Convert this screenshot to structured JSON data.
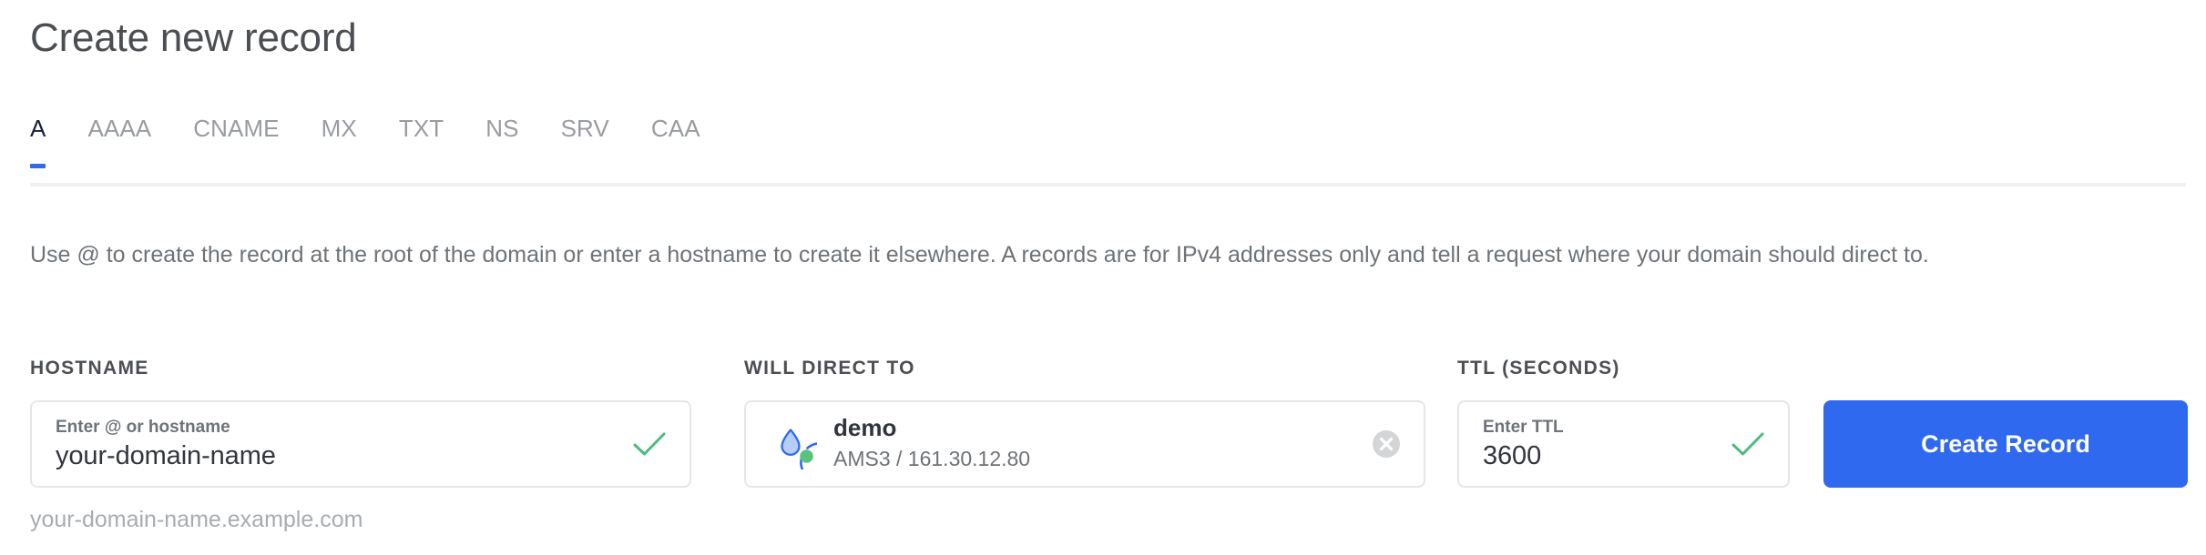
{
  "header": {
    "title": "Create new record"
  },
  "tabs": {
    "active_index": 0,
    "items": [
      {
        "label": "A"
      },
      {
        "label": "AAAA"
      },
      {
        "label": "CNAME"
      },
      {
        "label": "MX"
      },
      {
        "label": "TXT"
      },
      {
        "label": "NS"
      },
      {
        "label": "SRV"
      },
      {
        "label": "CAA"
      }
    ]
  },
  "description": "Use @ to create the record at the root of the domain or enter a hostname to create it elsewhere. A records are for IPv4 addresses only and tell a request where your domain should direct to.",
  "form": {
    "hostname": {
      "label": "HOSTNAME",
      "placeholder": "Enter @ or hostname",
      "value": "your-domain-name",
      "valid_icon": "check-icon",
      "helper_text": "your-domain-name.example.com"
    },
    "will_direct_to": {
      "label": "WILL DIRECT TO",
      "resource_icon": "droplet-icon",
      "resource_name": "demo",
      "resource_meta": "AMS3 / 161.30.12.80",
      "clear_icon": "clear-circle-icon"
    },
    "ttl": {
      "label": "TTL (SECONDS)",
      "placeholder": "Enter TTL",
      "value": "3600",
      "valid_icon": "check-icon"
    },
    "submit": {
      "label": "Create Record"
    }
  },
  "colors": {
    "accent_blue": "#2e69f0",
    "valid_green": "#4cbb7c",
    "status_green": "#5bc27e",
    "droplet_blue": "#2e69f0",
    "droplet_fill": "#b4cdfb",
    "text_muted": "#6e7378",
    "tab_inactive": "#989ca1",
    "tab_active": "#17203a",
    "border": "#e5e6e8"
  }
}
